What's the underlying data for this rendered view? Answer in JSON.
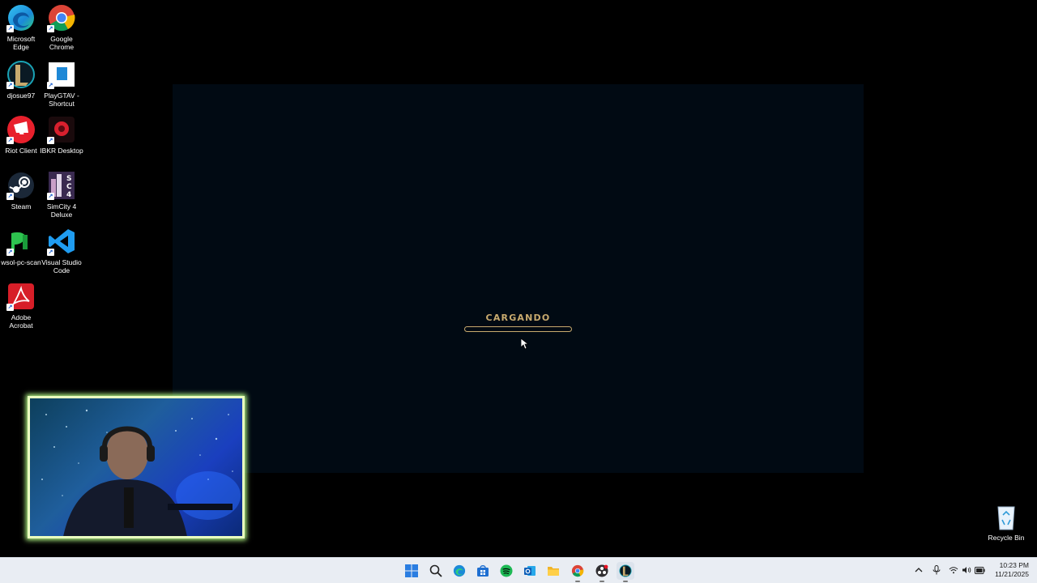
{
  "desktop": {
    "icons": [
      {
        "label": "Microsoft\nEdge",
        "icon": "edge-icon"
      },
      {
        "label": "Google\nChrome",
        "icon": "chrome-icon"
      },
      {
        "label": "djosue97",
        "icon": "league-icon"
      },
      {
        "label": "PlayGTAV -\nShortcut",
        "icon": "gtav-icon"
      },
      {
        "label": "Riot Client",
        "icon": "riot-icon"
      },
      {
        "label": "IBKR Desktop",
        "icon": "ibkr-icon"
      },
      {
        "label": "Steam",
        "icon": "steam-icon"
      },
      {
        "label": "SimCity 4\nDeluxe",
        "icon": "simcity-icon"
      },
      {
        "label": "wsol-pc-scan",
        "icon": "pc-scan-icon"
      },
      {
        "label": "Visual Studio\nCode",
        "icon": "vscode-icon"
      },
      {
        "label": "Adobe\nAcrobat",
        "icon": "acrobat-icon"
      }
    ],
    "recycle_bin": {
      "label": "Recycle Bin",
      "icon": "recycle-bin-icon"
    }
  },
  "game_window": {
    "loading_text": "CARGANDO",
    "progress": 0.0,
    "accent": "#c8aa6e",
    "background": "#010a13"
  },
  "taskbar": {
    "apps": [
      "windows-start-icon",
      "search-icon",
      "edge-icon",
      "store-icon",
      "spotify-icon",
      "outlook-icon",
      "file-explorer-icon",
      "chrome-icon",
      "obs-icon",
      "league-icon"
    ],
    "tray": [
      "chevron-up-icon",
      "microphone-icon",
      "wifi-icon",
      "volume-icon",
      "battery-icon"
    ],
    "time": "10:23 PM",
    "date": "11/21/2025"
  },
  "webcam": {
    "border_color": "#eaffc0"
  }
}
